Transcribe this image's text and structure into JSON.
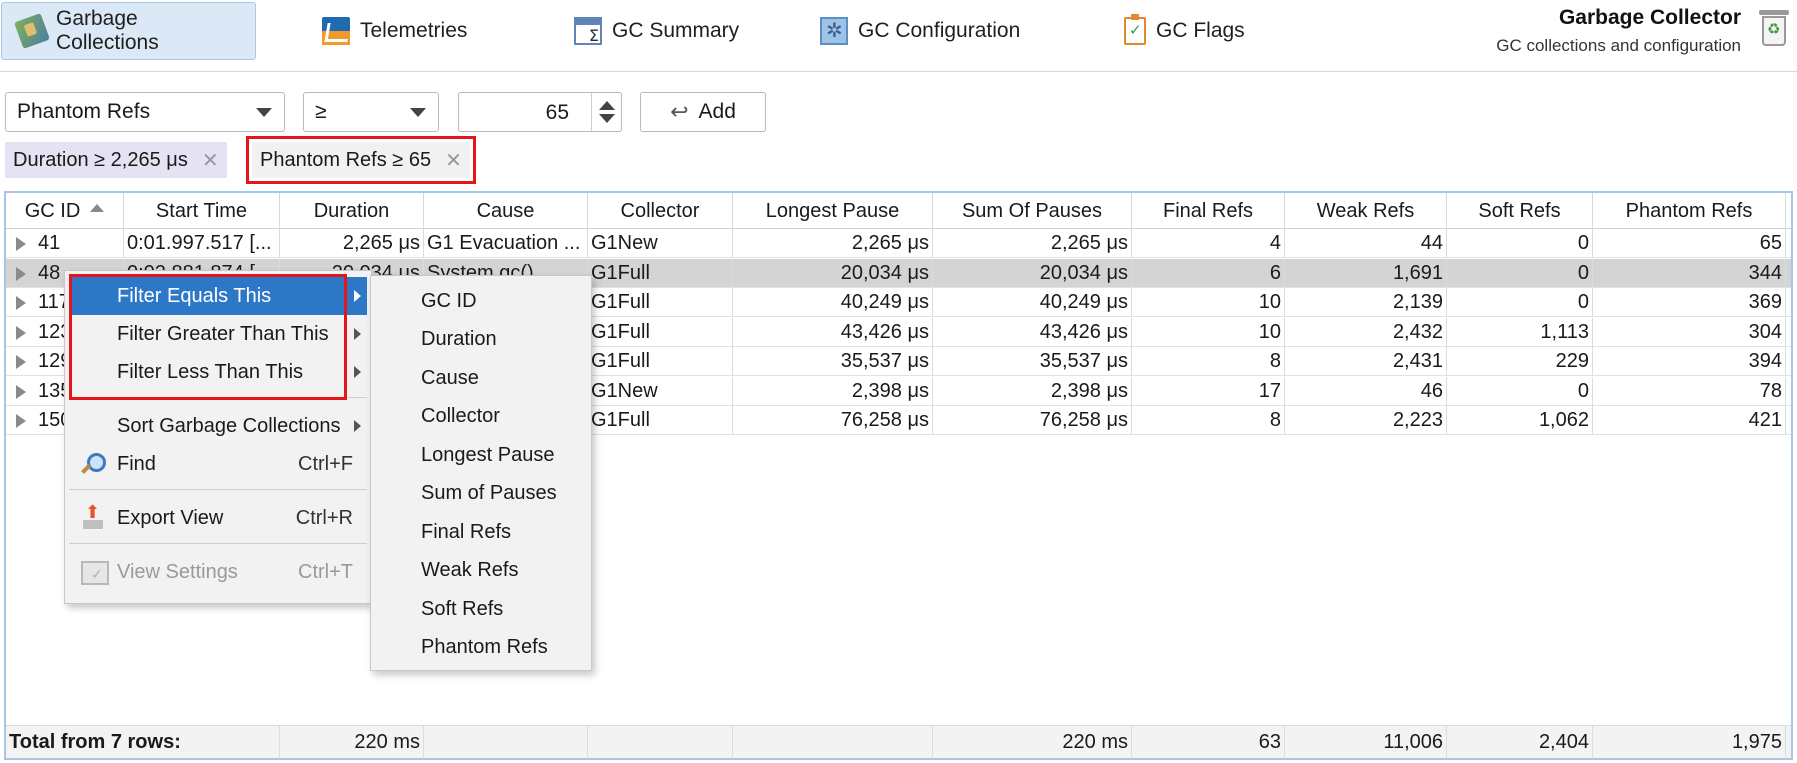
{
  "tabs": [
    {
      "label": "Garbage Collections",
      "icon": "garbage-collections-icon",
      "active": true
    },
    {
      "label": "Telemetries",
      "icon": "telemetries-icon",
      "active": false
    },
    {
      "label": "GC Summary",
      "icon": "gc-summary-icon",
      "active": false
    },
    {
      "label": "GC Configuration",
      "icon": "gc-configuration-icon",
      "active": false
    },
    {
      "label": "GC Flags",
      "icon": "gc-flags-icon",
      "active": false
    }
  ],
  "view": {
    "title": "Garbage Collector",
    "subtitle": "GC collections and configuration"
  },
  "filter": {
    "column": "Phantom Refs",
    "operator": "≥",
    "value": "65",
    "add_label": "Add"
  },
  "active_filters": [
    {
      "label": "Duration ≥ 2,265 μs"
    },
    {
      "label": "Phantom Refs ≥ 65"
    }
  ],
  "table": {
    "columns": [
      "GC ID",
      "Start Time",
      "Duration",
      "Cause",
      "Collector",
      "Longest Pause",
      "Sum Of Pauses",
      "Final Refs",
      "Weak Refs",
      "Soft Refs",
      "Phantom Refs"
    ],
    "sort_column": "GC ID",
    "rows": [
      [
        "41",
        "0:01.997.517 [...",
        "2,265 μs",
        "G1 Evacuation ...",
        "G1New",
        "2,265 μs",
        "2,265 μs",
        "4",
        "44",
        "0",
        "65"
      ],
      [
        "48",
        "0:02.881.874 [...",
        "20,034 μs",
        "System.gc()",
        "G1Full",
        "20,034 μs",
        "20,034 μs",
        "6",
        "1,691",
        "0",
        "344"
      ],
      [
        "117",
        "",
        "",
        "",
        "G1Full",
        "40,249 μs",
        "40,249 μs",
        "10",
        "2,139",
        "0",
        "369"
      ],
      [
        "123",
        "",
        "",
        "",
        "G1Full",
        "43,426 μs",
        "43,426 μs",
        "10",
        "2,432",
        "1,113",
        "304"
      ],
      [
        "129",
        "",
        "",
        "",
        "G1Full",
        "35,537 μs",
        "35,537 μs",
        "8",
        "2,431",
        "229",
        "394"
      ],
      [
        "135",
        "",
        "",
        "",
        "G1New",
        "2,398 μs",
        "2,398 μs",
        "17",
        "46",
        "0",
        "78"
      ],
      [
        "150",
        "",
        "",
        "",
        "G1Full",
        "76,258 μs",
        "76,258 μs",
        "8",
        "2,223",
        "1,062",
        "421"
      ]
    ],
    "selected_row": 1,
    "footer": [
      "Total from 7 rows:",
      "",
      "220 ms",
      "",
      "",
      "",
      "220 ms",
      "63",
      "11,006",
      "2,404",
      "1,975"
    ]
  },
  "context_menu": {
    "items": [
      {
        "label": "Filter Equals This",
        "submenu": true,
        "highlighted": true
      },
      {
        "label": "Filter Greater Than This",
        "submenu": true
      },
      {
        "label": "Filter Less Than This",
        "submenu": true
      },
      {
        "label": "Sort Garbage Collections",
        "submenu": true
      },
      {
        "label": "Find",
        "shortcut": "Ctrl+F",
        "icon": "find-icon"
      },
      {
        "label": "Export View",
        "shortcut": "Ctrl+R",
        "icon": "export-icon"
      },
      {
        "label": "View Settings",
        "shortcut": "Ctrl+T",
        "icon": "view-settings-icon",
        "disabled": true
      }
    ],
    "submenu_items": [
      "GC ID",
      "Duration",
      "Cause",
      "Collector",
      "Longest Pause",
      "Sum of Pauses",
      "Final Refs",
      "Weak Refs",
      "Soft Refs",
      "Phantom Refs"
    ]
  },
  "colors": {
    "highlight_red": "#e3161b",
    "menu_selection": "#2d78c6",
    "active_tab": "#dbe9f6",
    "filter_chip": "#e3e3f3"
  }
}
